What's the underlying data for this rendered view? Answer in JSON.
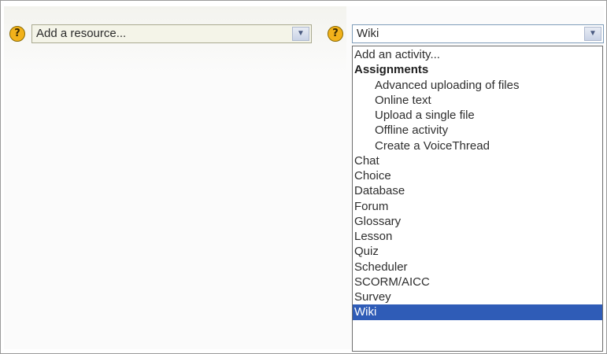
{
  "resource_selector": {
    "help_icon_glyph": "?",
    "value": "Add a resource..."
  },
  "activity_selector": {
    "help_icon_glyph": "?",
    "value": "Wiki",
    "options": [
      {
        "label": "Add an activity...",
        "kind": "header"
      },
      {
        "label": "Assignments",
        "kind": "group"
      },
      {
        "label": "Advanced uploading of files",
        "kind": "indented"
      },
      {
        "label": "Online text",
        "kind": "indented"
      },
      {
        "label": "Upload a single file",
        "kind": "indented"
      },
      {
        "label": "Offline activity",
        "kind": "indented"
      },
      {
        "label": "Create a VoiceThread",
        "kind": "indented"
      },
      {
        "label": "Chat",
        "kind": "item"
      },
      {
        "label": "Choice",
        "kind": "item"
      },
      {
        "label": "Database",
        "kind": "item"
      },
      {
        "label": "Forum",
        "kind": "item"
      },
      {
        "label": "Glossary",
        "kind": "item"
      },
      {
        "label": "Lesson",
        "kind": "item"
      },
      {
        "label": "Quiz",
        "kind": "item"
      },
      {
        "label": "Scheduler",
        "kind": "item"
      },
      {
        "label": "SCORM/AICC",
        "kind": "item"
      },
      {
        "label": "Survey",
        "kind": "item"
      },
      {
        "label": "Wiki",
        "kind": "item",
        "selected": true
      }
    ]
  },
  "colors": {
    "help_icon": "#f2b21b",
    "selected_highlight": "#2f5cb7"
  }
}
